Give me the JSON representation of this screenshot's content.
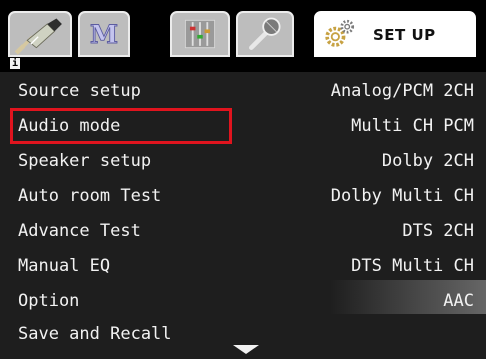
{
  "tabs": [
    {
      "icon": "cable-plug-icon"
    },
    {
      "icon": "m-letter-icon",
      "letter": "M"
    },
    {
      "icon": "equalizer-icon"
    },
    {
      "icon": "microphone-icon"
    },
    {
      "icon": "gears-icon",
      "label": "SET UP"
    }
  ],
  "info_mark": "i",
  "menu": {
    "items": [
      {
        "label": "Source setup",
        "value": "Analog/PCM 2CH"
      },
      {
        "label": "Audio mode",
        "value": "Multi CH PCM"
      },
      {
        "label": "Speaker setup",
        "value": "Dolby 2CH"
      },
      {
        "label": "Auto room Test",
        "value": "Dolby Multi CH"
      },
      {
        "label": "Advance Test",
        "value": "DTS 2CH"
      },
      {
        "label": "Manual EQ",
        "value": "DTS Multi CH"
      },
      {
        "label": "Option",
        "value": "AAC"
      },
      {
        "label": "Save and Recall",
        "value": ""
      }
    ],
    "selected": "Audio mode"
  },
  "colors": {
    "background": "#000000",
    "menu_background": "#1e1e1e",
    "text": "#f2f2f2",
    "tab": "#bdbdbd",
    "selection": "#e0141e"
  }
}
